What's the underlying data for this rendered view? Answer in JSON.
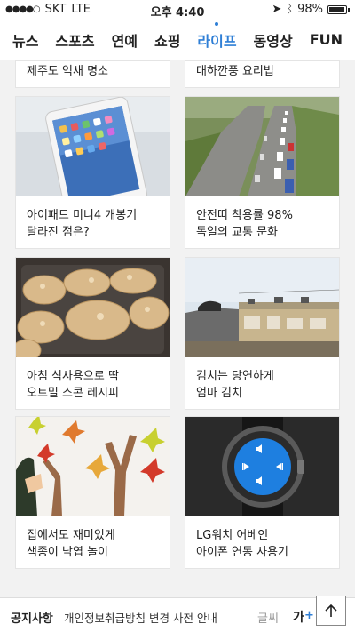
{
  "status": {
    "carrier": "SKT",
    "network": "LTE",
    "time": "오후 4:40",
    "battery": "98%"
  },
  "tabs": [
    {
      "label": "뉴스"
    },
    {
      "label": "스포츠"
    },
    {
      "label": "연예"
    },
    {
      "label": "쇼핑"
    },
    {
      "label": "라이프"
    },
    {
      "label": "동영상"
    },
    {
      "label": "FUN"
    }
  ],
  "active_tab": "라이프",
  "top_cards": [
    {
      "caption": "제주도 억새 명소"
    },
    {
      "caption": "대하깐풍 요리법"
    }
  ],
  "cards": [
    {
      "line1": "아이패드 미니4 개봉기",
      "line2": "달라진 점은?",
      "image": "ipad-photo"
    },
    {
      "line1": "안전띠 착용률 98%",
      "line2": "독일의 교통 문화",
      "image": "highway-photo"
    },
    {
      "line1": "아침 식사용으로 딱",
      "line2": "오트밀 스콘 레시피",
      "image": "scones-photo"
    },
    {
      "line1": "김치는 당연하게",
      "line2": "엄마 김치",
      "image": "rooftop-photo"
    },
    {
      "line1": "집에서도 재미있게",
      "line2": "색종이 낙엽 놀이",
      "image": "paper-leaves-photo"
    },
    {
      "line1": "LG워치 어베인",
      "line2": "아이폰 연동 사용기",
      "image": "smartwatch-photo"
    }
  ],
  "bottom": {
    "notice_title": "공지사항",
    "notice_text": "개인정보취급방침 변경 사전 안내",
    "font_label": "글씨",
    "font_sample": "가",
    "font_more": "+"
  },
  "colors": {
    "accent": "#2f7fd6"
  }
}
